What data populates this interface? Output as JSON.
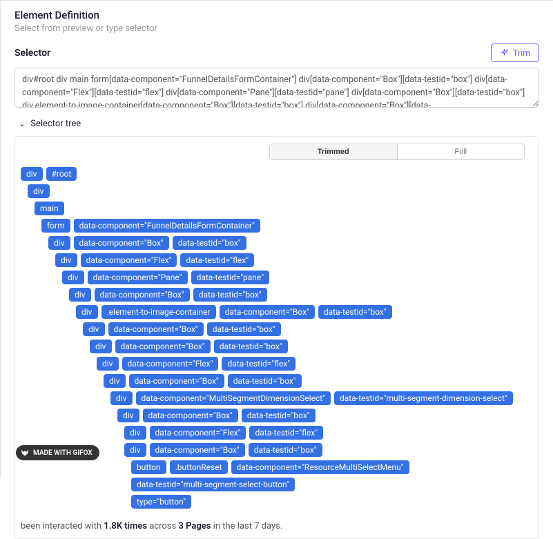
{
  "header": {
    "title": "Element Definition",
    "subtitle": "Select from preview or type selector"
  },
  "selector_section": {
    "label": "Selector",
    "trim_button": "Trim"
  },
  "selector_textarea": "div#root div main form[data-component=\"FunnelDetailsFormContainer\"] div[data-component=\"Box\"][data-testid=\"box\"] div[data-component=\"Flex\"][data-testid=\"flex\"] div[data-component=\"Pane\"][data-testid=\"pane\"] div[data-component=\"Box\"][data-testid=\"box\"] div.element-to-image-container[data-component=\"Box\"][data-testid=\"box\"] div[data-component=\"Box\"][data-",
  "tree_section": {
    "label": "Selector tree",
    "toggle": {
      "trimmed": "Trimmed",
      "full": "Full",
      "active": "trimmed"
    }
  },
  "tree": [
    {
      "indent": 0,
      "chips": [
        "div",
        "#root"
      ]
    },
    {
      "indent": 1,
      "chips": [
        "div"
      ]
    },
    {
      "indent": 2,
      "chips": [
        "main"
      ]
    },
    {
      "indent": 3,
      "chips": [
        "form",
        "data-component=\"FunnelDetailsFormContainer\""
      ]
    },
    {
      "indent": 4,
      "chips": [
        "div",
        "data-component=\"Box\"",
        "data-testid=\"box\""
      ]
    },
    {
      "indent": 5,
      "chips": [
        "div",
        "data-component=\"Flex\"",
        "data-testid=\"flex\""
      ]
    },
    {
      "indent": 6,
      "chips": [
        "div",
        "data-component=\"Pane\"",
        "data-testid=\"pane\""
      ]
    },
    {
      "indent": 7,
      "chips": [
        "div",
        "data-component=\"Box\"",
        "data-testid=\"box\""
      ]
    },
    {
      "indent": 8,
      "chips": [
        "div",
        ".element-to-image-container",
        "data-component=\"Box\"",
        "data-testid=\"box\""
      ]
    },
    {
      "indent": 9,
      "chips": [
        "div",
        "data-component=\"Box\"",
        "data-testid=\"box\""
      ]
    },
    {
      "indent": 10,
      "chips": [
        "div",
        "data-component=\"Box\"",
        "data-testid=\"box\""
      ]
    },
    {
      "indent": 11,
      "chips": [
        "div",
        "data-component=\"Flex\"",
        "data-testid=\"flex\""
      ]
    },
    {
      "indent": 12,
      "chips": [
        "div",
        "data-component=\"Box\"",
        "data-testid=\"box\""
      ]
    },
    {
      "indent": 13,
      "chips": [
        "div",
        "data-component=\"MultiSegmentDimensionSelect\"",
        "data-testid=\"multi-segment-dimension-select\""
      ]
    },
    {
      "indent": 14,
      "chips": [
        "div",
        "data-component=\"Box\"",
        "data-testid=\"box\""
      ]
    },
    {
      "indent": 15,
      "chips": [
        "div",
        "data-component=\"Flex\"",
        "data-testid=\"flex\""
      ]
    },
    {
      "indent": 15,
      "chips": [
        "div",
        "data-component=\"Box\"",
        "data-testid=\"box\""
      ]
    },
    {
      "indent": 16,
      "chips": [
        "button",
        ".buttonReset",
        "data-component=\"ResourceMultiSelectMenu\"",
        "data-testid=\"multi-segment-select-button\""
      ]
    },
    {
      "indent": 16,
      "chips": [
        "type=\"button\""
      ]
    }
  ],
  "footer": {
    "pre": "been interacted with ",
    "count": "1.8K times",
    "mid": " across ",
    "pages": "3 Pages",
    "post": " in the last 7 days."
  },
  "badge": "MADE WITH GIFOX"
}
